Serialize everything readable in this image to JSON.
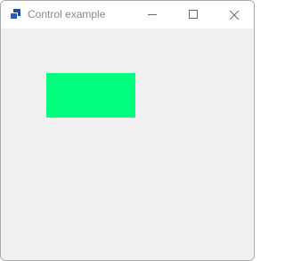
{
  "window": {
    "title": "Control example",
    "icon": "app-window-icon",
    "caption_buttons": {
      "minimize_icon": "minimize-icon",
      "maximize_icon": "maximize-icon",
      "close_icon": "close-icon"
    }
  },
  "client": {
    "background_color": "#f0f0f0",
    "panel": {
      "color": "#00ff7f"
    }
  }
}
